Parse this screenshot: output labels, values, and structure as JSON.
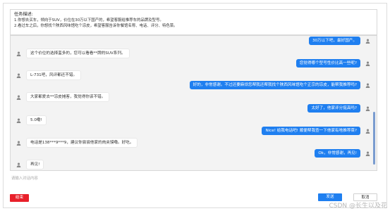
{
  "task": {
    "title": "任务描述:",
    "lines": [
      "1.你想去买车，倾向于SUV，价位在30万以下国产的，希望客服给推荐车的品牌及型号。",
      "2.看过车之后，你想找个陕西风味馆吃个凉皮，希望客服告诉你餐馆名称、电话、评分、特色菜。"
    ]
  },
  "messages": [
    {
      "role": "user",
      "text": "30万以下吧，最好国产。"
    },
    {
      "role": "bot",
      "text": "这个价位的选择蛮多的，您可以看看**牌的SUV系列。"
    },
    {
      "role": "user",
      "text": "您觉得哪个型号性价比高一些呢?"
    },
    {
      "role": "bot",
      "text": "L-731吧，风评都还不错。"
    },
    {
      "role": "user",
      "text": "好的，非常感谢。不过还要麻烦您帮我还帮我找个陕西风味馆吃个正宗的凉皮，能帮我推荐吗?"
    },
    {
      "role": "bot",
      "text": "大家都爱去**凉皮摊客，我觉得你该不错。"
    },
    {
      "role": "user",
      "text": "太好了，他家评分挺高吗?"
    },
    {
      "role": "bot",
      "text": "5.0嘞!"
    },
    {
      "role": "user",
      "text": "Nice! 给我电话吧! 顺便帮我查一下他家有啥推荐菜?"
    },
    {
      "role": "bot",
      "text": "电话是138***9***9，建议你尝尝他家的肉夹馍嘞。好吃。"
    },
    {
      "role": "user",
      "text": "Ok，非常感谢，再见!"
    },
    {
      "role": "bot",
      "text": "再见!"
    }
  ],
  "input": {
    "placeholder": "请输入对话内容"
  },
  "buttons": {
    "end": "结束",
    "send": "发送",
    "cancel": "取消"
  },
  "watermark": "CSDN @长生以及花",
  "colors": {
    "user_bubble": "#1f7ff0",
    "end_button": "#e8202a",
    "send_button": "#1f7ff0"
  }
}
